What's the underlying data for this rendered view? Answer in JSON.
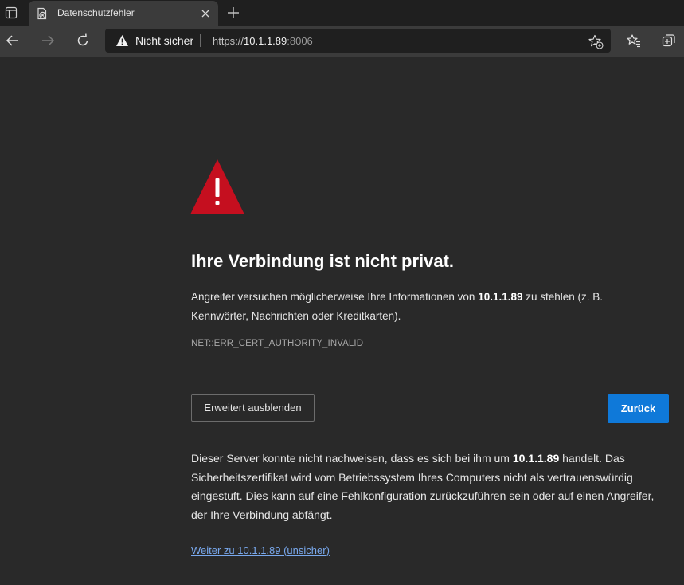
{
  "tab": {
    "title": "Datenschutzfehler"
  },
  "omnibox": {
    "security_label": "Nicht sicher",
    "url_scheme": "https",
    "url_separator": "://",
    "url_host": "10.1.1.89",
    "url_port": ":8006"
  },
  "icons": {
    "tab_actions": "tab-actions-icon",
    "favicon": "certificate-error-icon",
    "tab_close": "close-icon",
    "new_tab": "plus-icon",
    "back": "arrow-left-icon",
    "forward": "arrow-right-icon",
    "reload": "reload-icon",
    "security_warning": "warning-triangle-icon",
    "add_favorite": "star-add-icon",
    "favorites": "favorites-list-icon",
    "collections": "collections-icon"
  },
  "page": {
    "heading": "Ihre Verbindung ist nicht privat.",
    "summary_before": "Angreifer versuchen möglicherweise Ihre Informationen von ",
    "summary_host": "10.1.1.89",
    "summary_after": " zu stehlen (z. B. Kennwörter, Nachrichten oder Kreditkarten).",
    "error_code": "NET::ERR_CERT_AUTHORITY_INVALID",
    "advanced_button": "Erweitert ausblenden",
    "back_button": "Zurück",
    "details_before": "Dieser Server konnte nicht nachweisen, dass es sich bei ihm um ",
    "details_host": "10.1.1.89",
    "details_after": " handelt. Das Sicherheitszertifikat wird vom Betriebssystem Ihres Computers nicht als vertrauenswürdig eingestuft. Dies kann auf eine Fehlkonfiguration zurückzuführen sein oder auf einen Angreifer, der Ihre Verbindung abfängt.",
    "proceed_link": "Weiter zu 10.1.1.89 (unsicher)"
  },
  "colors": {
    "page_background": "#292929",
    "warning_red": "#c50f1f",
    "primary_button": "#0f79d9",
    "link": "#79a9ee"
  }
}
